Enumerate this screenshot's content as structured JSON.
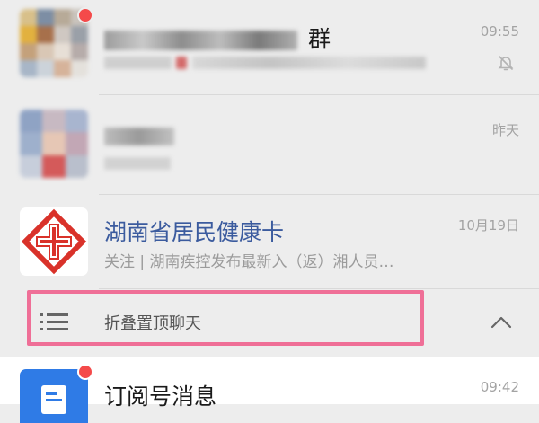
{
  "chats": [
    {
      "title_suffix": "群",
      "time": "09:55",
      "muted": true,
      "unread_dot": true,
      "icon": "bell-muted-icon",
      "masked_text": true
    },
    {
      "time": "昨天",
      "masked_text": true
    },
    {
      "title": "湖南省居民健康卡",
      "subtitle": "关注 | 湖南疾控发布最新入（返）湘人员…",
      "time": "10月19日",
      "avatar_icon": "red-cross-icon",
      "accent": "#d9322a"
    },
    {
      "title": "订阅号消息",
      "time": "09:42",
      "unread_dot": true,
      "avatar_icon": "subscription-icon",
      "accent": "#2f7be6"
    }
  ],
  "folded": {
    "label": "折叠置顶聊天",
    "icon_left": "list-icon",
    "icon_right": "chevron-up-icon",
    "highlight_color": "#ef6f97"
  },
  "colors": {
    "background": "#ededed",
    "unread": "#f44a4a",
    "title_blue": "#3b5b9e"
  }
}
